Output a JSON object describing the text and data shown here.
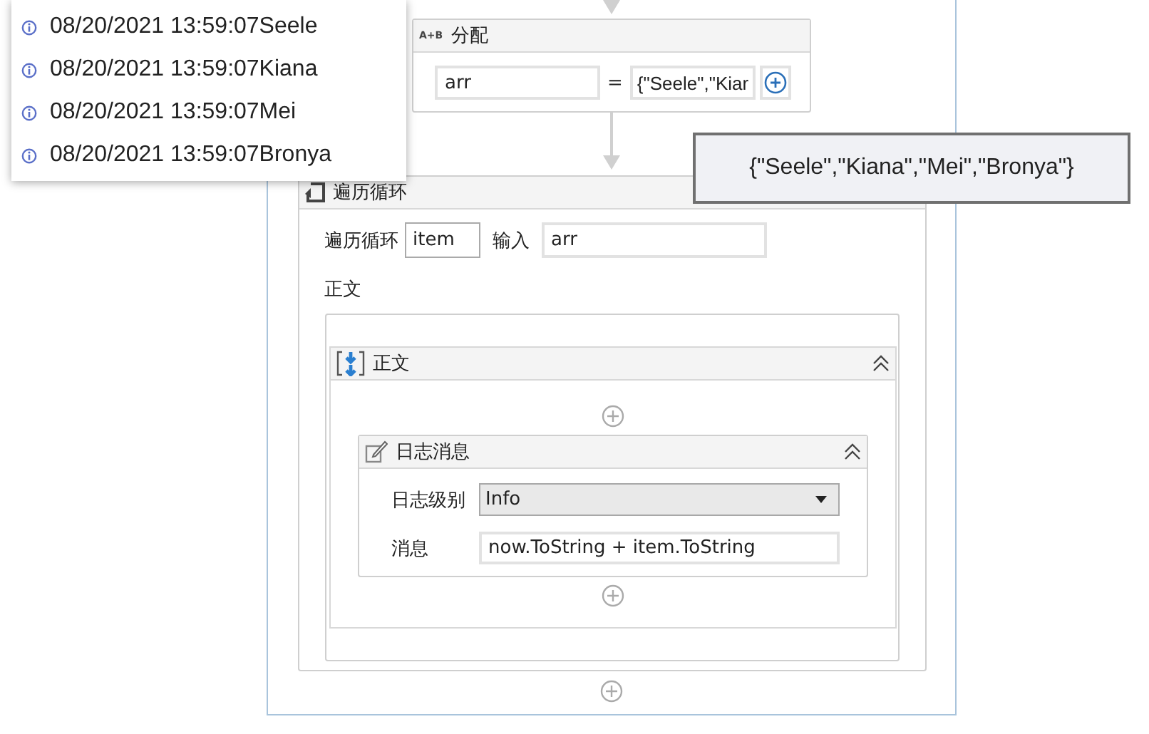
{
  "log_output": [
    {
      "text": "08/20/2021 13:59:07Seele"
    },
    {
      "text": "08/20/2021 13:59:07Kiana"
    },
    {
      "text": "08/20/2021 13:59:07Mei"
    },
    {
      "text": "08/20/2021 13:59:07Bronya"
    }
  ],
  "assign": {
    "icon_text": "A+B",
    "title": "分配",
    "to": "arr",
    "operator": "=",
    "value": "{\"Seele\",\"Kiar"
  },
  "foreach": {
    "title": "遍历循环",
    "loop_label": "遍历循环",
    "item": "item",
    "input_label": "输入",
    "input": "arr",
    "body_label": "正文",
    "sequence": {
      "title": "正文",
      "expanded": true,
      "log": {
        "title": "日志消息",
        "expanded": true,
        "level_label": "日志级别",
        "level": "Info",
        "message_label": "消息",
        "message": "now.ToString + item.ToString"
      }
    }
  },
  "tooltip": {
    "text": "{\"Seele\",\"Kiana\",\"Mei\",\"Bronya\"}"
  }
}
